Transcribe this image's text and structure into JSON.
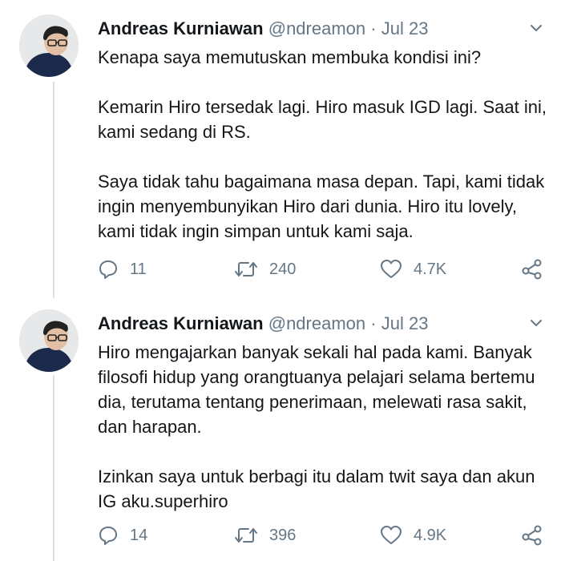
{
  "tweets": [
    {
      "author_name": "Andreas Kurniawan",
      "handle": "@ndreamon",
      "separator": "·",
      "date": "Jul 23",
      "paragraphs": [
        "Kenapa saya memutuskan membuka kondisi ini?",
        "Kemarin Hiro tersedak lagi. Hiro masuk IGD lagi. Saat ini, kami sedang di RS.",
        "Saya tidak tahu bagaimana masa depan. Tapi, kami tidak ingin menyembunyikan Hiro dari dunia. Hiro itu lovely, kami tidak ingin simpan untuk kami saja."
      ],
      "replies": "11",
      "retweets": "240",
      "likes": "4.7K"
    },
    {
      "author_name": "Andreas Kurniawan",
      "handle": "@ndreamon",
      "separator": "·",
      "date": "Jul 23",
      "paragraphs": [
        "Hiro mengajarkan banyak sekali hal pada kami. Banyak filosofi hidup yang orangtuanya pelajari selama bertemu dia, terutama tentang penerimaan, melewati rasa sakit, dan harapan.",
        "Izinkan saya untuk berbagi itu dalam twit saya dan akun IG aku.superhiro"
      ],
      "replies": "14",
      "retweets": "396",
      "likes": "4.9K"
    }
  ],
  "icons": {
    "reply": "reply-icon",
    "retweet": "retweet-icon",
    "like": "heart-icon",
    "share": "share-icon",
    "menu": "chevron-down-icon"
  },
  "colors": {
    "text": "#14171a",
    "secondary": "#657786",
    "thread_line": "#dadfe3"
  }
}
